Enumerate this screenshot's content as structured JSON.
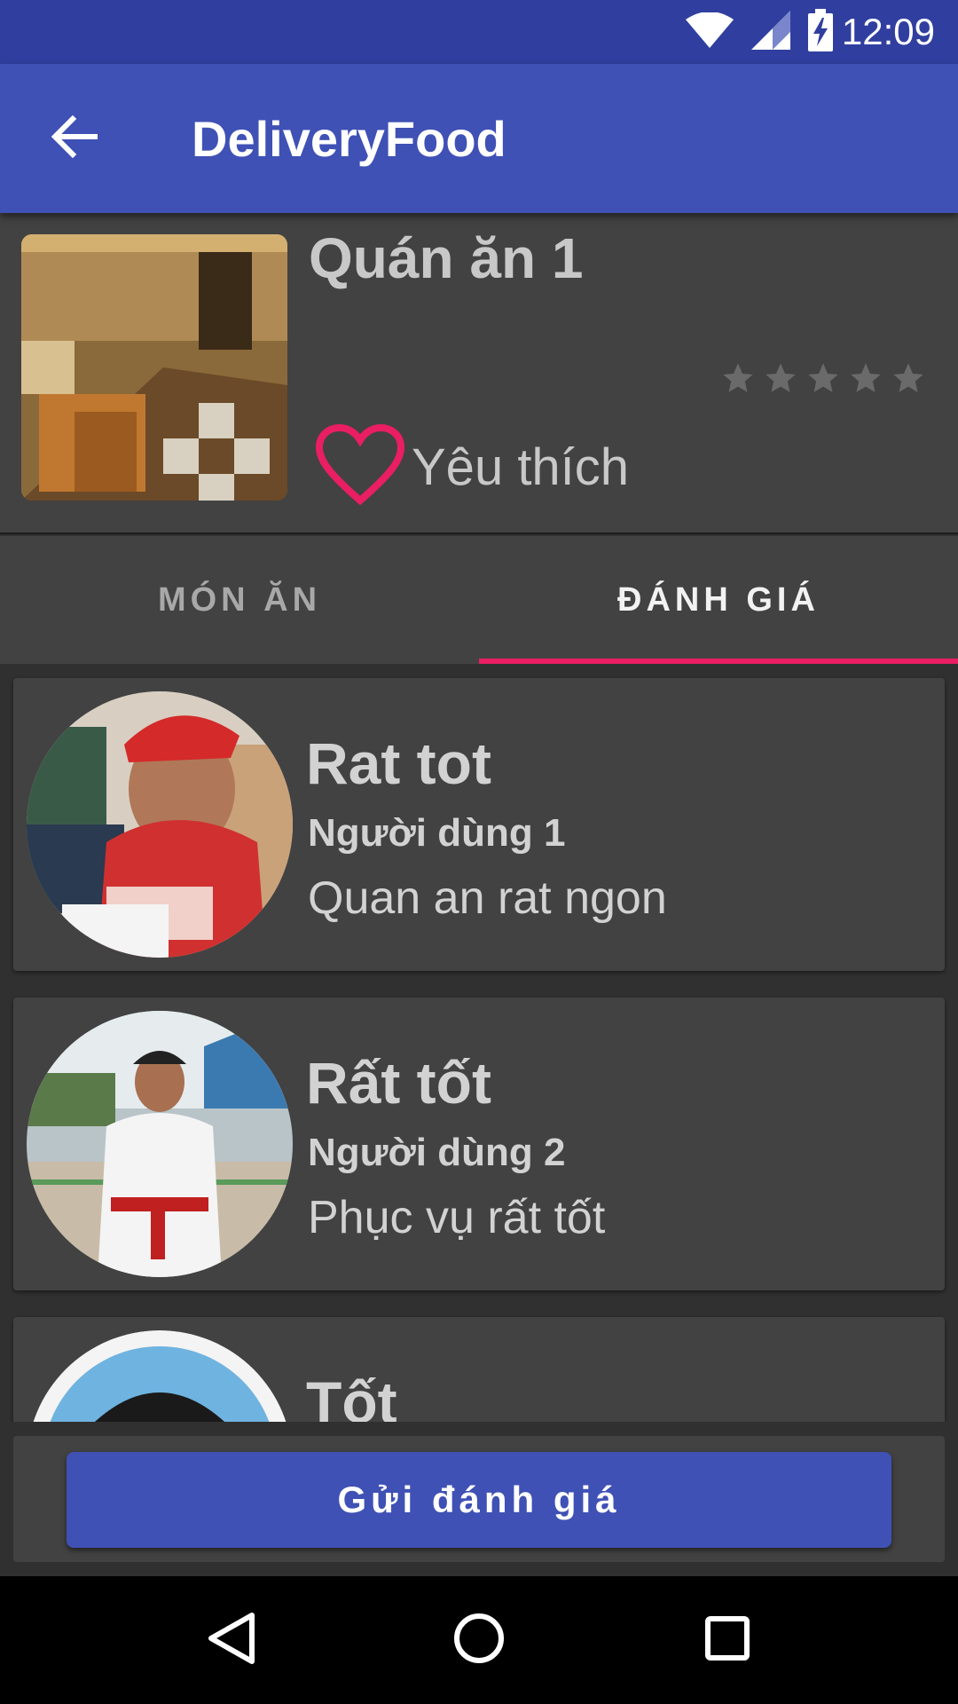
{
  "status_bar": {
    "time": "12:09",
    "icons": [
      "wifi-icon",
      "cell-signal-icon",
      "battery-charging-icon"
    ]
  },
  "app_bar": {
    "title": "DeliveryFood",
    "back_icon": "arrow-back-icon"
  },
  "restaurant": {
    "name": "Quán ăn 1",
    "rating": 0,
    "rating_max": 5,
    "favorite_label": "Yêu thích",
    "favorite_icon": "heart-outline-icon"
  },
  "tabs": [
    {
      "label": "MÓN ĂN",
      "active": false
    },
    {
      "label": "ĐÁNH GIÁ",
      "active": true
    }
  ],
  "reviews": [
    {
      "title": "Rat tot",
      "user": "Người dùng 1",
      "text": "Quan an rat ngon"
    },
    {
      "title": "Rất tốt",
      "user": "Người dùng 2",
      "text": "Phục vụ rất tốt"
    },
    {
      "title": "Tốt",
      "user": "",
      "text": ""
    }
  ],
  "submit_button": {
    "label": "Gửi đánh giá"
  },
  "nav_bar": {
    "icons": [
      "nav-back-icon",
      "nav-home-icon",
      "nav-recents-icon"
    ]
  },
  "colors": {
    "primary": "#3F51B5",
    "primary_dark": "#303F9F",
    "accent": "#E91E63",
    "background": "#303030",
    "card": "#424242"
  }
}
